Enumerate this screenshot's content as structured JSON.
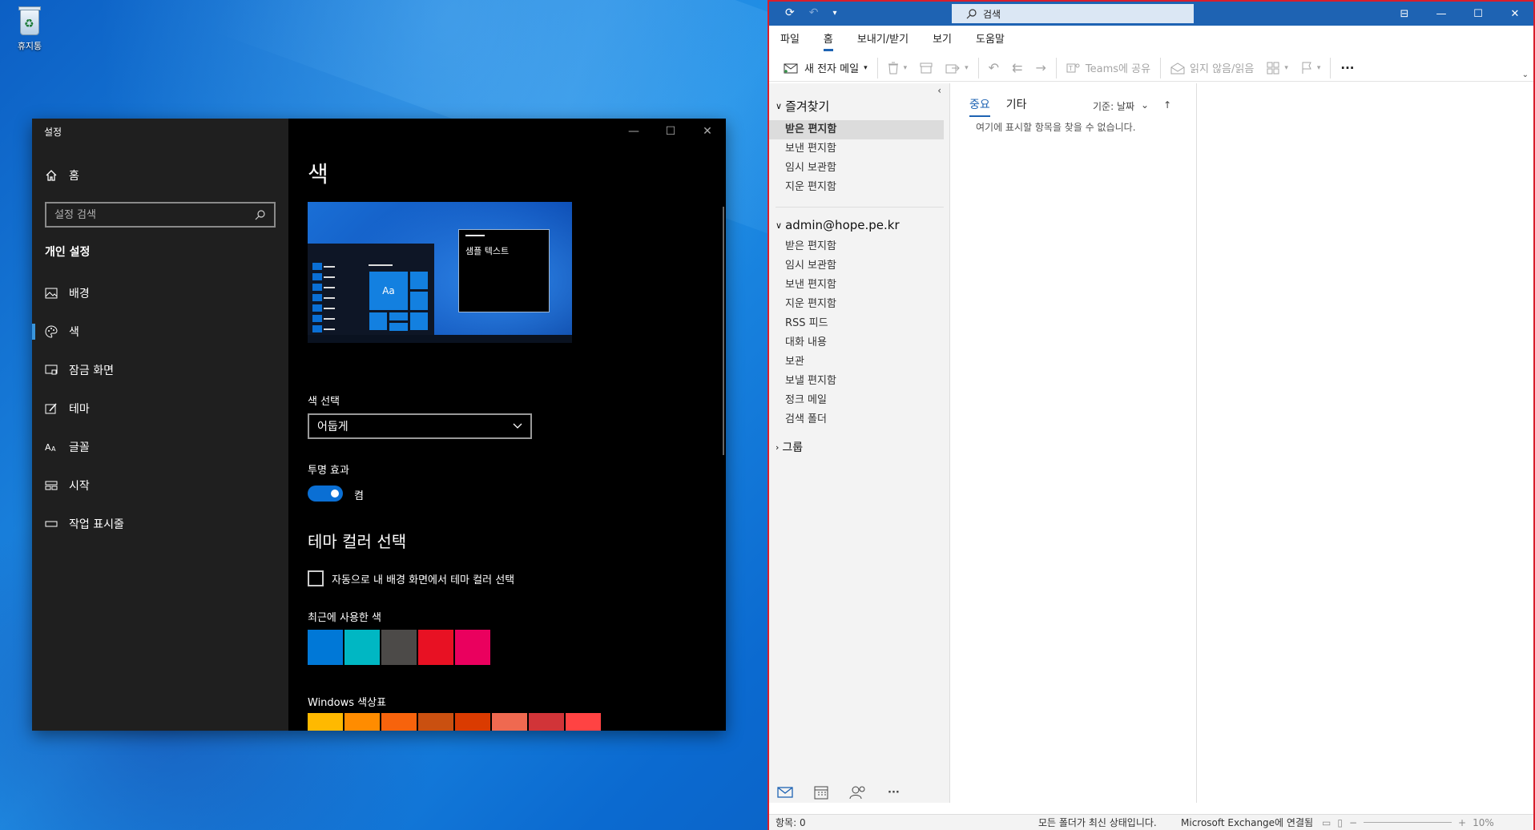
{
  "desktop": {
    "recycle_bin_label": "휴지통"
  },
  "settings": {
    "window_title": "설정",
    "home_label": "홈",
    "search_placeholder": "설정 검색",
    "group_title": "개인 설정",
    "nav": [
      {
        "label": "배경",
        "icon": "picture-icon"
      },
      {
        "label": "색",
        "icon": "palette-icon",
        "active": true
      },
      {
        "label": "잠금 화면",
        "icon": "lock-screen-icon"
      },
      {
        "label": "테마",
        "icon": "theme-icon"
      },
      {
        "label": "글꼴",
        "icon": "font-icon"
      },
      {
        "label": "시작",
        "icon": "start-icon"
      },
      {
        "label": "작업 표시줄",
        "icon": "taskbar-icon"
      }
    ],
    "page_title": "색",
    "preview_sample_text": "샘플 텍스트",
    "preview_tile_text": "Aa",
    "color_select_label": "색 선택",
    "color_select_value": "어둡게",
    "transparency_label": "투명 효과",
    "transparency_value": "켬",
    "transparency_on": true,
    "accent_heading": "테마 컬러 선택",
    "auto_accent_label": "자동으로 내 배경 화면에서 테마 컬러 선택",
    "auto_accent_checked": false,
    "recent_colors_label": "최근에 사용한 색",
    "recent_colors": [
      "#0078d7",
      "#00b7c3",
      "#4c4a48",
      "#e81123",
      "#ea005e"
    ],
    "windows_colors_label": "Windows 색상표",
    "windows_colors": [
      "#ffb900",
      "#ff8c00",
      "#f7630c",
      "#ca5010",
      "#da3b01",
      "#ef6950",
      "#d13438",
      "#ff4343"
    ]
  },
  "outlook": {
    "search_placeholder": "검색",
    "menu": [
      {
        "label": "파일"
      },
      {
        "label": "홈",
        "active": true
      },
      {
        "label": "보내기/받기"
      },
      {
        "label": "보기"
      },
      {
        "label": "도움말"
      }
    ],
    "toolbar": {
      "new_mail": "새 전자 메일",
      "teams_share": "Teams에 공유",
      "read_unread": "읽지 않음/읽음",
      "more": "···"
    },
    "favorites_title": "즐겨찾기",
    "favorites": [
      "받은 편지함",
      "보낸 편지함",
      "임시 보관함",
      "지운 편지함"
    ],
    "account": "admin@hope.pe.kr",
    "account_folders": [
      "받은 편지함",
      "임시 보관함",
      "보낸 편지함",
      "지운 편지함",
      "RSS 피드",
      "대화 내용",
      "보관",
      "보낼 편지함",
      "정크 메일",
      "검색 폴더"
    ],
    "groups_title": "그룹",
    "tabs": [
      "중요",
      "기타"
    ],
    "sort_label": "기준: 날짜",
    "empty_message": "여기에 표시할 항목을 찾을 수 없습니다.",
    "status": {
      "items": "항목: 0",
      "folders": "모든 폴더가 최신 상태입니다.",
      "connection": "Microsoft Exchange에 연결됨",
      "zoom": "10%"
    }
  },
  "colors": {
    "accent": "#0078d7",
    "outlook_blue": "#1e63b3",
    "highlight_border": "#d81e2c"
  }
}
